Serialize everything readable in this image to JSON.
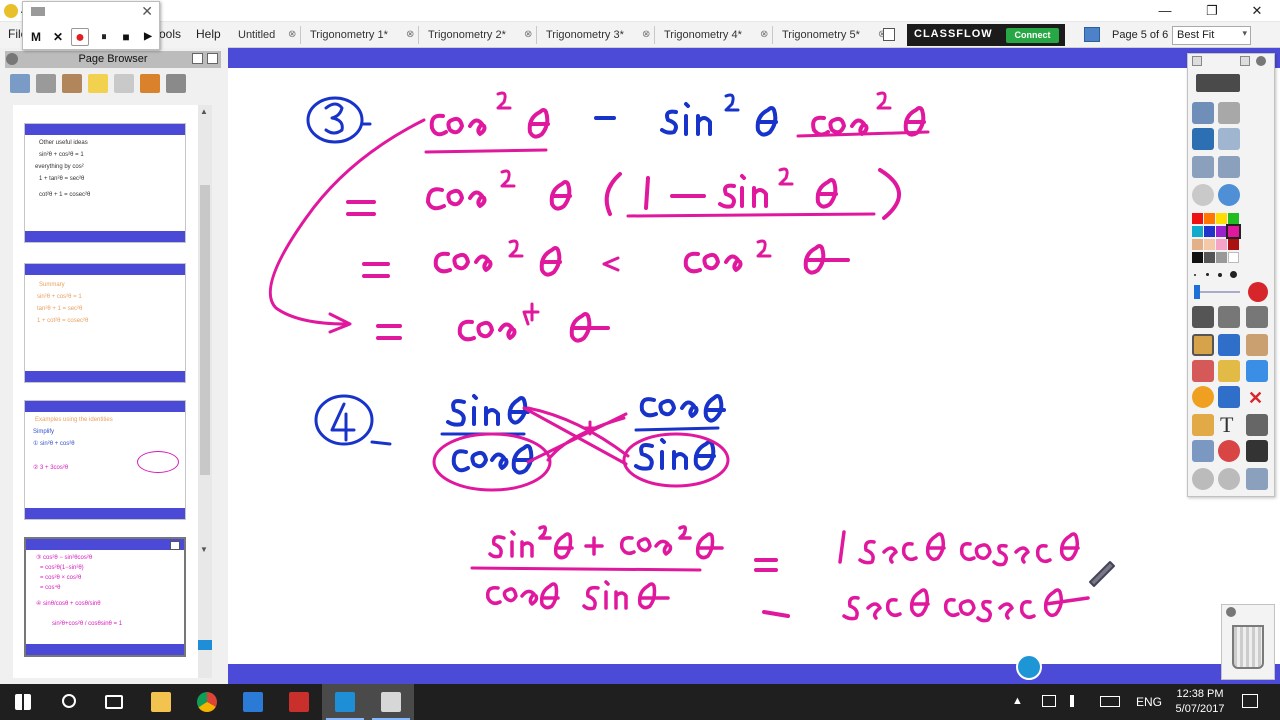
{
  "app": {
    "title": "A"
  },
  "window_controls": {
    "minimize": "—",
    "maximize": "❐",
    "close": "✕"
  },
  "menu": {
    "file": "File",
    "tools": "Tools",
    "help": "Help"
  },
  "recorder": {
    "m": "M",
    "x": "✕",
    "record": "●",
    "pause": "⏸",
    "stop": "■",
    "play": "▶",
    "close": "✕"
  },
  "tabs": [
    {
      "label": "Untitled",
      "close": "⊗"
    },
    {
      "label": "Trigonometry 1*",
      "close": "⊗"
    },
    {
      "label": "Trigonometry 2*",
      "close": "⊗"
    },
    {
      "label": "Trigonometry 3*",
      "close": "⊗"
    },
    {
      "label": "Trigonometry 4*",
      "close": "⊗"
    },
    {
      "label": "Trigonometry 5*",
      "close": "⊗"
    }
  ],
  "classflow": {
    "brand": "CLASSFLOW",
    "connect": "Connect"
  },
  "page_info": "Page 5 of 6",
  "zoom": {
    "value": "Best Fit",
    "arrow": "▾"
  },
  "page_browser": {
    "title": "Page Browser",
    "thumbnails": [
      {
        "lines": [
          "Other useful ideas",
          "sin²θ + cos²θ = 1",
          "everything by cos²",
          "1 + tan²θ = sec²θ",
          "cot²θ + 1 = cosec²θ"
        ]
      },
      {
        "lines": [
          "Summary",
          "sin²θ + cos²θ = 1",
          "tan²θ + 1 = sec²θ",
          "1 + cot²θ = cosec²θ"
        ]
      },
      {
        "lines": [
          "Examples using the identities",
          "Simplify",
          "① sin²θ + cos²θ",
          "② 3 + 3cos²θ"
        ]
      },
      {
        "lines": [
          "③ cos²θ − sin²θcos²θ",
          "= cos²θ(1−sin²θ)",
          "= cos²θ × cos²θ",
          "= cos⁴θ",
          "④ sinθ/cosθ + cosθ/sinθ",
          "sin²θ+cos²θ / cosθsinθ = 1"
        ]
      }
    ]
  },
  "taskbar": {
    "language": "ENG",
    "time": "12:38 PM",
    "date": "5/07/2017"
  },
  "colors": {
    "ink": "#e0189e",
    "blue_ink": "#1833c9",
    "frame": "#4b4bd8",
    "accent": "#28a745"
  }
}
